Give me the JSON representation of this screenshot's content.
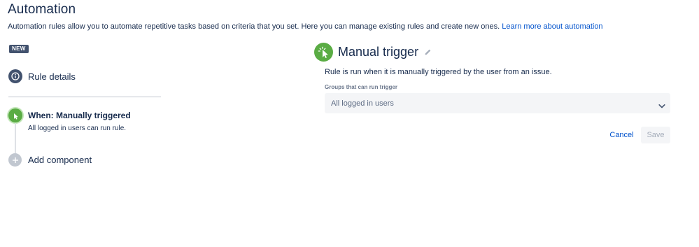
{
  "header": {
    "title": "Automation",
    "description": "Automation rules allow you to automate repetitive tasks based on criteria that you set. Here you can manage existing rules and create new ones.",
    "learn_more_link": "Learn more about automation"
  },
  "badge": {
    "label": "NEW"
  },
  "steps": {
    "rule_details": {
      "label": "Rule details",
      "icon": "info-icon"
    },
    "trigger": {
      "title": "When: Manually triggered",
      "subtitle": "All logged in users can run rule.",
      "icon": "cursor-click-icon"
    },
    "add_component": {
      "label": "Add component",
      "icon": "plus-icon"
    }
  },
  "panel": {
    "title": "Manual trigger",
    "icon": "cursor-click-icon",
    "edit_icon": "pencil-icon",
    "description": "Rule is run when it is manually triggered by the user from an issue.",
    "field_label": "Groups that can run trigger",
    "select_value": "All logged in users",
    "cancel_label": "Cancel",
    "save_label": "Save"
  },
  "colors": {
    "green": "#5aac44",
    "dark_icon": "#42526e",
    "link": "#0052cc",
    "text": "#172b4d",
    "field_bg": "#f4f5f7"
  }
}
